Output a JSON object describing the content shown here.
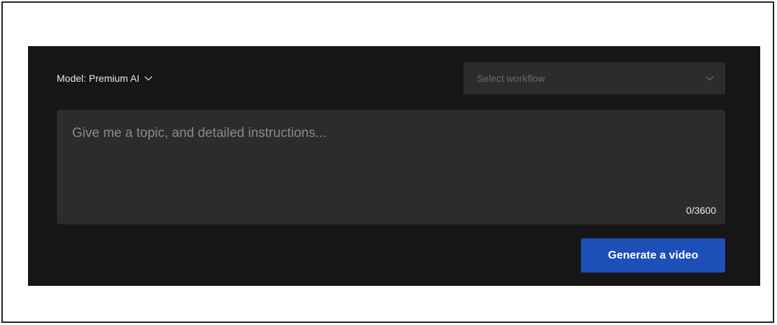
{
  "model": {
    "label": "Model: Premium AI",
    "icon": "chevron-down-icon"
  },
  "workflow": {
    "placeholder": "Select workflow",
    "icon": "chevron-down-icon"
  },
  "prompt": {
    "placeholder": "Give me a topic, and detailed instructions...",
    "value": "",
    "char_count": "0/3600"
  },
  "actions": {
    "generate_label": "Generate a video"
  },
  "colors": {
    "panel_bg": "#161616",
    "input_bg": "#2c2c2c",
    "accent": "#1d4fb8"
  }
}
